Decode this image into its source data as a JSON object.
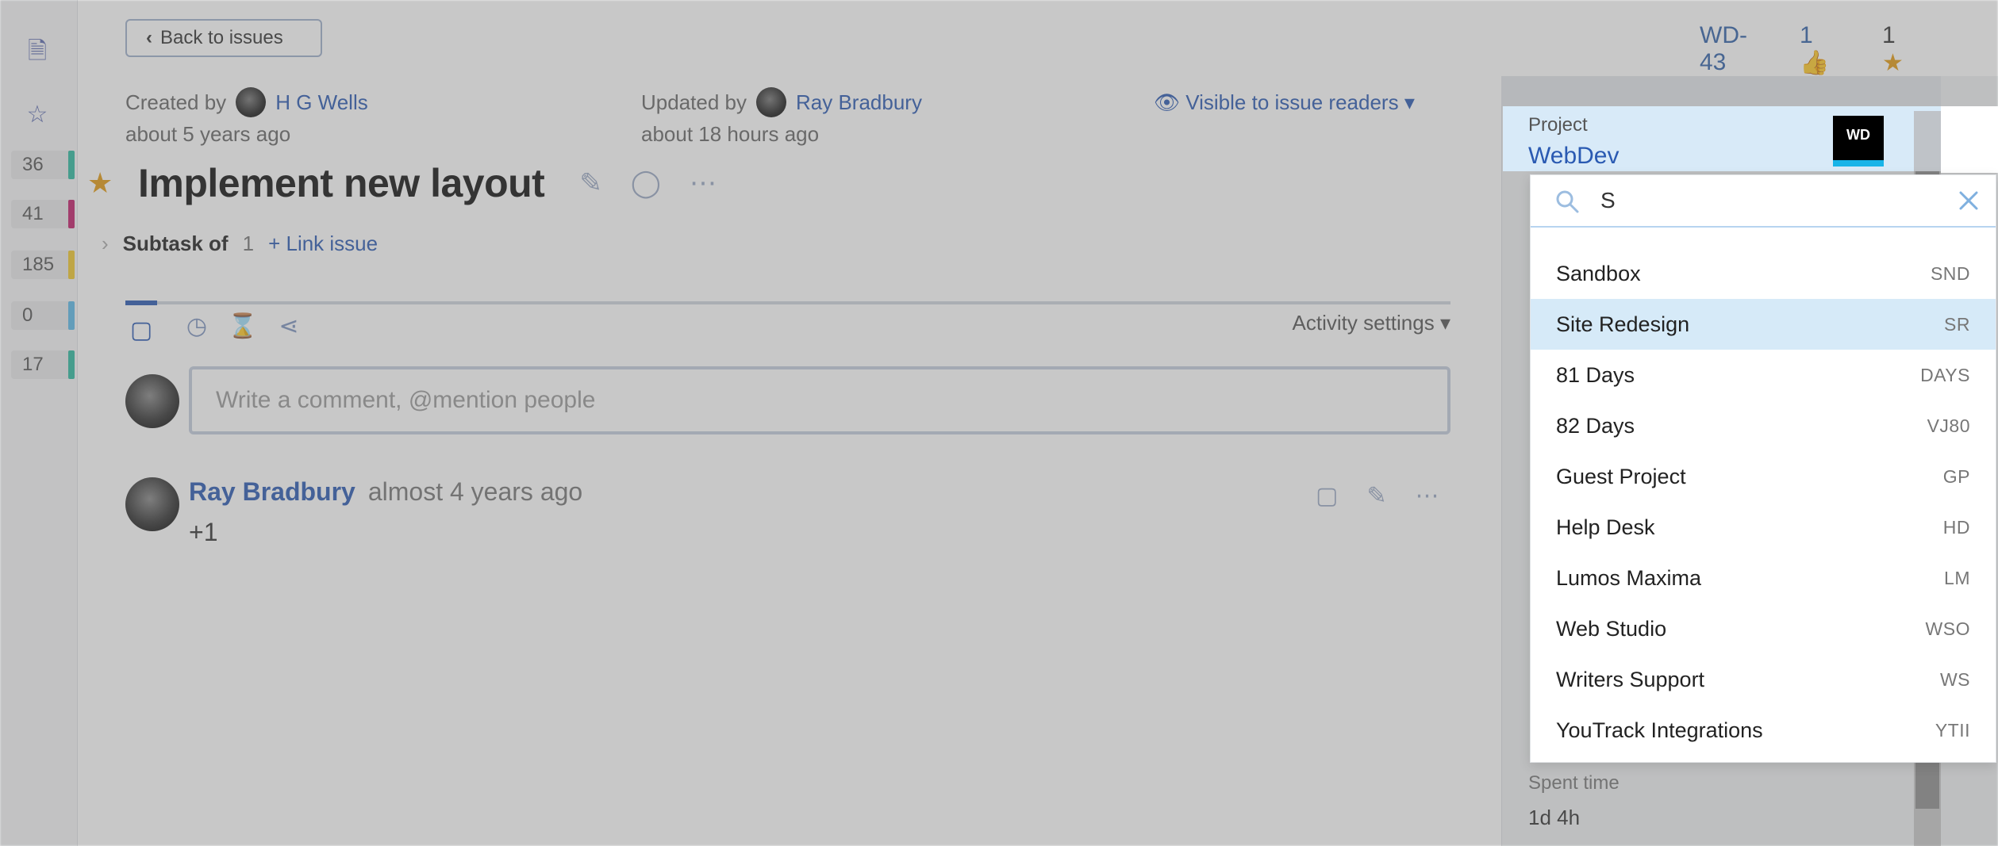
{
  "rail": {
    "counts": [
      {
        "value": "36",
        "color": "#2ebaa0"
      },
      {
        "value": "41",
        "color": "#c21f6b"
      },
      {
        "value": "185",
        "color": "#f0c92e"
      },
      {
        "value": "0",
        "color": "#5dbae8"
      },
      {
        "value": "17",
        "color": "#2ebaa0"
      }
    ]
  },
  "header": {
    "back_label": "Back to issues",
    "issue_id": "WD-43",
    "votes": "1",
    "stars": "1",
    "created_label": "Created by",
    "created_by": "H G Wells",
    "created_when": "about 5 years ago",
    "updated_label": "Updated by",
    "updated_by": "Ray Bradbury",
    "updated_when": "about 18 hours ago",
    "visibility": "Visible to issue readers"
  },
  "issue": {
    "title": "Implement new layout",
    "subtask_label": "Subtask of",
    "subtask_count": "1",
    "link_issue": "Link issue"
  },
  "activity": {
    "settings_label": "Activity settings",
    "comment_placeholder": "Write a comment, @mention people",
    "comments": [
      {
        "author": "Ray Bradbury",
        "when": "almost 4 years ago",
        "text": "+1"
      }
    ]
  },
  "side": {
    "project_label": "Project",
    "project_value": "WebDev",
    "project_logo_text": "WD",
    "spent_label": "Spent time",
    "spent_value": "1d 4h"
  },
  "dropdown": {
    "query": "S",
    "items": [
      {
        "name": "Sandbox",
        "code": "SND"
      },
      {
        "name": "Site Redesign",
        "code": "SR",
        "selected": true
      },
      {
        "name": "81 Days",
        "code": "DAYS"
      },
      {
        "name": "82 Days",
        "code": "VJ80"
      },
      {
        "name": "Guest Project",
        "code": "GP"
      },
      {
        "name": "Help Desk",
        "code": "HD"
      },
      {
        "name": "Lumos Maxima",
        "code": "LM"
      },
      {
        "name": "Web Studio",
        "code": "WSO"
      },
      {
        "name": "Writers Support",
        "code": "WS"
      },
      {
        "name": "YouTrack Integrations",
        "code": "YTII"
      }
    ]
  }
}
